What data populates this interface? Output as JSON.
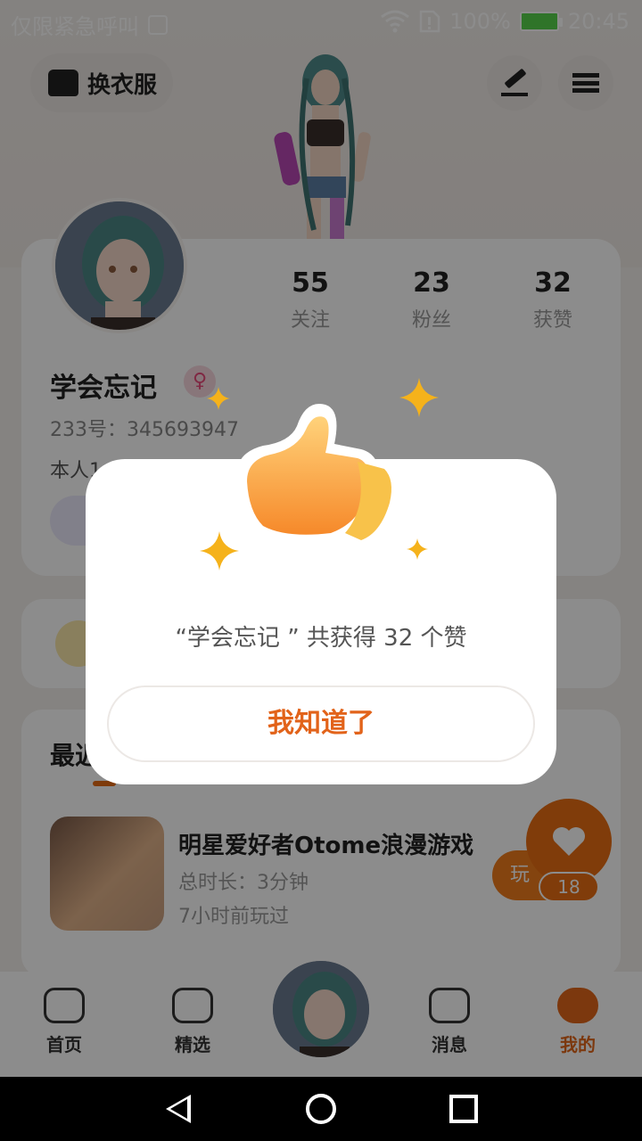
{
  "status_bar": {
    "carrier": "仅限紧急呼叫",
    "battery": "100%",
    "time": "20:45"
  },
  "header": {
    "outfit_button": "换衣服"
  },
  "profile": {
    "stats": [
      {
        "num": "55",
        "label": "关注"
      },
      {
        "num": "23",
        "label": "粉丝"
      },
      {
        "num": "32",
        "label": "获赞"
      }
    ],
    "username": "学会忘记",
    "uid": "233号：345693947",
    "bio_partial": "本人1"
  },
  "recent": {
    "title_partial": "最近",
    "game": {
      "title": "明星爱好者Otome浪漫游戏",
      "duration": "总时长：3分钟",
      "last_played": "7小时前玩过",
      "play_label": "玩",
      "likes": "18"
    }
  },
  "bottom_nav": [
    {
      "label": "首页",
      "active": false
    },
    {
      "label": "精选",
      "active": false
    },
    {
      "label": "消息",
      "active": false
    },
    {
      "label": "我的",
      "active": true
    }
  ],
  "dialog": {
    "message": "“学会忘记 ” 共获得 32 个赞",
    "confirm": "我知道了"
  },
  "colors": {
    "accent": "#e2631a",
    "star": "#f5b21b"
  }
}
